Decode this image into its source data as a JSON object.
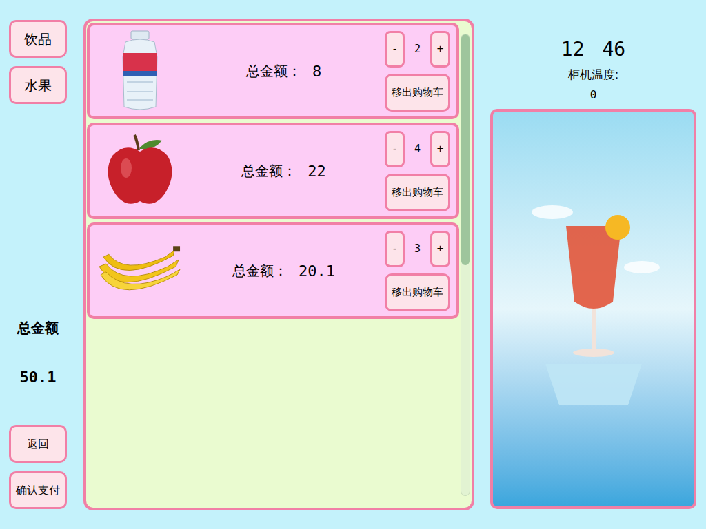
{
  "categories": [
    {
      "label": "饮品"
    },
    {
      "label": "水果"
    }
  ],
  "cart": [
    {
      "kind": "water",
      "label": "总金额：",
      "amount": "8",
      "minus": "-",
      "count": "2",
      "plus": "+",
      "remove": "移出购物车"
    },
    {
      "kind": "apple",
      "label": "总金额：",
      "amount": "22",
      "minus": "-",
      "count": "4",
      "plus": "+",
      "remove": "移出购物车"
    },
    {
      "kind": "banana",
      "label": "总金额：",
      "amount": "20.1",
      "minus": "-",
      "count": "3",
      "plus": "+",
      "remove": "移出购物车"
    }
  ],
  "scrollbar": {
    "level": 0.5
  },
  "total": {
    "label": "总金额",
    "value": "50.1"
  },
  "buttons": {
    "back": "返回",
    "pay": "确认支付"
  },
  "clock": {
    "hours": "12",
    "minutes": "46"
  },
  "temperature": {
    "label": "柜机温度:",
    "value": "0"
  }
}
